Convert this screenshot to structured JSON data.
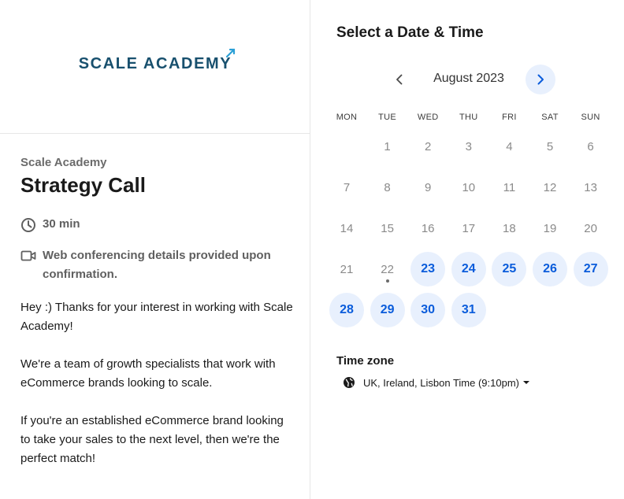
{
  "brand": {
    "logo_text": "SCALE ACADEMY"
  },
  "event": {
    "organizer": "Scale Academy",
    "title": "Strategy Call",
    "duration": "30 min",
    "conferencing": "Web conferencing details provided upon confirmation.",
    "description": [
      "Hey :) Thanks for your interest in working with Scale Academy!",
      "We're a team of growth specialists that work with eCommerce brands looking to scale.",
      "If you're an established eCommerce brand looking to take your sales to the next level, then we're the perfect match!"
    ]
  },
  "calendar": {
    "heading": "Select a Date & Time",
    "month_label": "August 2023",
    "weekdays": [
      "MON",
      "TUE",
      "WED",
      "THU",
      "FRI",
      "SAT",
      "SUN"
    ],
    "days": [
      {
        "d": "1",
        "available": false
      },
      {
        "d": "2",
        "available": false
      },
      {
        "d": "3",
        "available": false
      },
      {
        "d": "4",
        "available": false
      },
      {
        "d": "5",
        "available": false
      },
      {
        "d": "6",
        "available": false
      },
      {
        "d": "7",
        "available": false
      },
      {
        "d": "8",
        "available": false
      },
      {
        "d": "9",
        "available": false
      },
      {
        "d": "10",
        "available": false
      },
      {
        "d": "11",
        "available": false
      },
      {
        "d": "12",
        "available": false
      },
      {
        "d": "13",
        "available": false
      },
      {
        "d": "14",
        "available": false
      },
      {
        "d": "15",
        "available": false
      },
      {
        "d": "16",
        "available": false
      },
      {
        "d": "17",
        "available": false
      },
      {
        "d": "18",
        "available": false
      },
      {
        "d": "19",
        "available": false
      },
      {
        "d": "20",
        "available": false
      },
      {
        "d": "21",
        "available": false
      },
      {
        "d": "22",
        "available": false,
        "today": true
      },
      {
        "d": "23",
        "available": true
      },
      {
        "d": "24",
        "available": true
      },
      {
        "d": "25",
        "available": true
      },
      {
        "d": "26",
        "available": true
      },
      {
        "d": "27",
        "available": true
      },
      {
        "d": "28",
        "available": true
      },
      {
        "d": "29",
        "available": true
      },
      {
        "d": "30",
        "available": true
      },
      {
        "d": "31",
        "available": true
      }
    ],
    "first_weekday_index": 1
  },
  "timezone": {
    "label": "Time zone",
    "value": "UK, Ireland, Lisbon Time (9:10pm)"
  },
  "colors": {
    "brand_navy": "#18506e",
    "accent_blue": "#0a5cdb",
    "available_bg": "#e8f0fd"
  },
  "icons": {
    "duration": "clock-icon",
    "conferencing": "video-camera-icon",
    "prev": "chevron-left-icon",
    "next": "chevron-right-icon",
    "timezone": "globe-icon"
  }
}
